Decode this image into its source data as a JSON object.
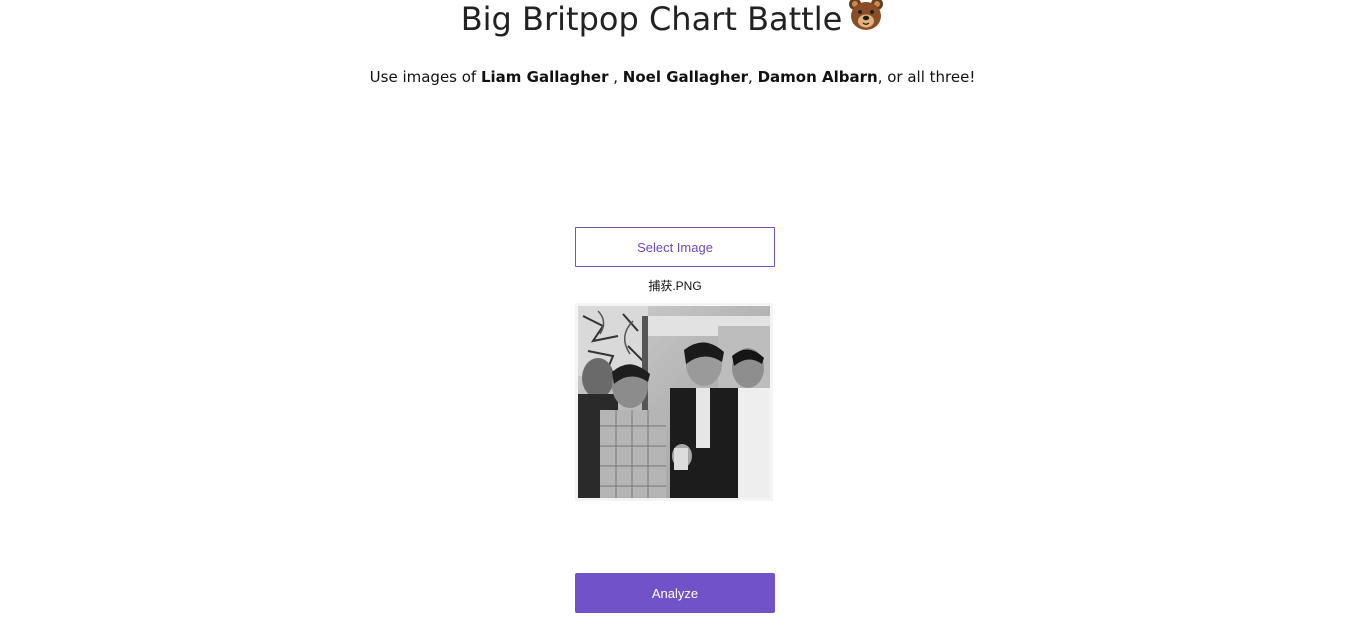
{
  "header": {
    "title": "Big Britpop Chart Battle",
    "title_emoji": "bear-face-icon"
  },
  "subtitle": {
    "prefix": "Use images of ",
    "name1": "Liam Gallagher",
    "sep1": " , ",
    "name2": "Noel Gallagher",
    "sep2": ", ",
    "name3": "Damon Albarn",
    "suffix": ", or all three!"
  },
  "upload": {
    "select_label": "Select Image",
    "filename": "捕获.PNG"
  },
  "actions": {
    "analyze_label": "Analyze"
  },
  "colors": {
    "accent": "#7252c9",
    "text": "#222222",
    "background": "#ffffff"
  }
}
